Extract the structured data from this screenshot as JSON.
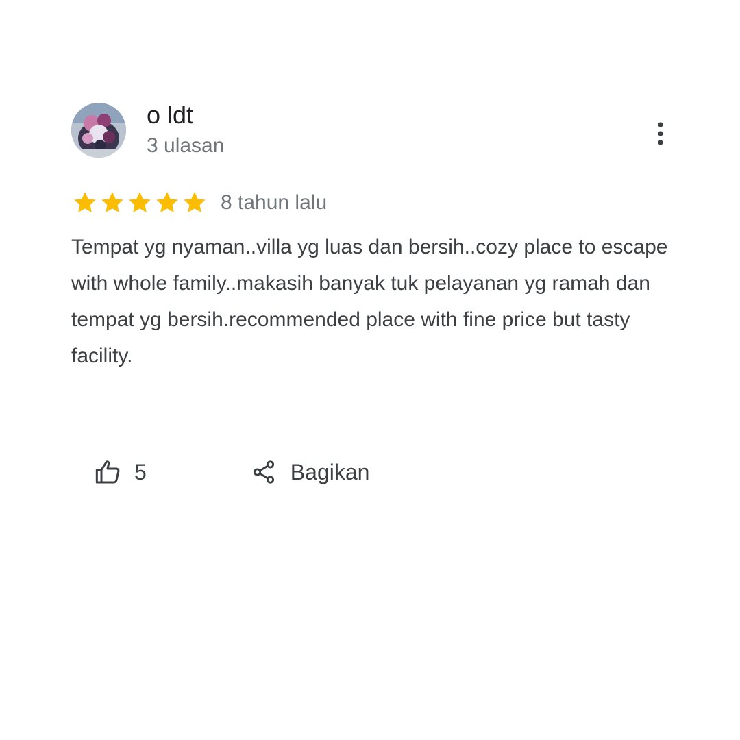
{
  "review": {
    "reviewer": {
      "name": "o ldt",
      "review_count": "3 ulasan",
      "avatar": "profile-photo"
    },
    "rating": {
      "stars": 5,
      "max": 5,
      "star_color": "#fbbc04"
    },
    "date": "8 tahun lalu",
    "text": "Tempat yg nyaman..villa yg luas dan bersih..cozy place to escape with whole family..makasih banyak tuk pelayanan yg ramah dan tempat yg bersih.recommended place with fine price but tasty facility.",
    "actions": {
      "like_icon": "thumbs-up-icon",
      "like_count": "5",
      "share_icon": "share-icon",
      "share_label": "Bagikan",
      "menu_icon": "more-vert-icon"
    }
  },
  "colors": {
    "background": "#ffffff",
    "text_primary": "#202124",
    "text_secondary": "#70757a",
    "star": "#fbbc04"
  }
}
